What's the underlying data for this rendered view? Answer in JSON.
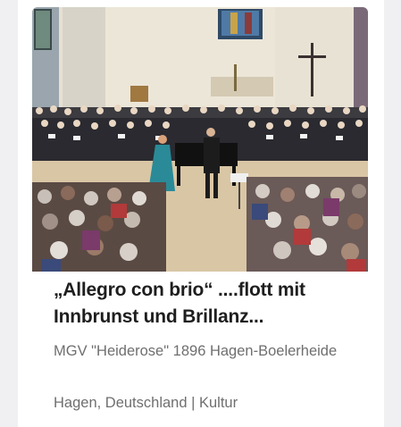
{
  "article": {
    "title": "„Allegro con brio“ ....flott mit Innbrunst und Brillanz...",
    "organizer": "MGV \"Heiderose\" 1896 Hagen-Boelerheide",
    "location": "Hagen, Deutschland",
    "separator": "|",
    "category": "Kultur",
    "image_alt": "Choir concert in a church with pianist in blue dress and conductor"
  },
  "colors": {
    "title_text": "#1e1e1e",
    "meta_text": "#6f6f6f",
    "card_background": "#ffffff",
    "page_background": "#f0f0f2"
  }
}
